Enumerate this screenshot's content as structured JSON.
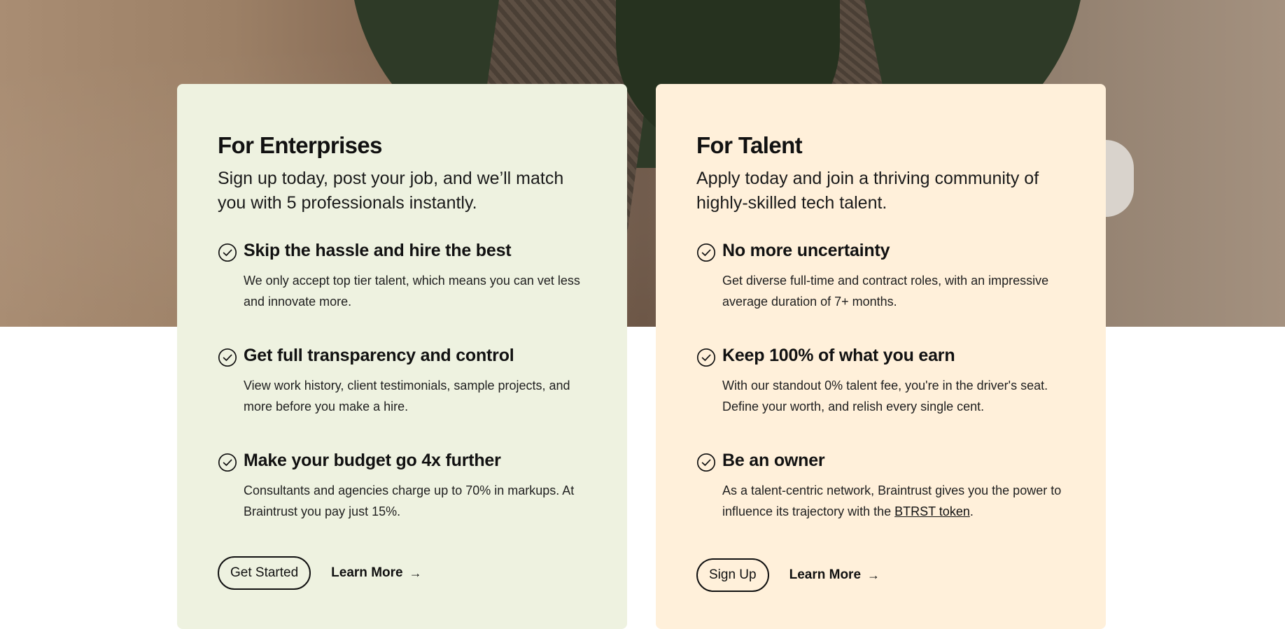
{
  "enterprise": {
    "title": "For Enterprises",
    "subtitle": "Sign up today, post your job, and we’ll match you with 5 professionals instantly.",
    "features": [
      {
        "heading": "Skip the hassle and hire the best",
        "description": "We only accept top tier talent, which means you can vet less and innovate more."
      },
      {
        "heading": "Get full transparency and control",
        "description": "View work history, client testimonials, sample projects, and more before you make a hire."
      },
      {
        "heading": "Make your budget go 4x further",
        "description": "Consultants and agencies charge up to 70% in markups. At Braintrust you pay just 15%."
      }
    ],
    "primary_button": "Get Started",
    "learn_more": "Learn More",
    "icon": "check-circle-icon"
  },
  "talent": {
    "title": "For Talent",
    "subtitle": "Apply today and join a thriving community of highly-skilled tech talent.",
    "features": [
      {
        "heading": "No more uncertainty",
        "description": "Get diverse full-time and contract roles, with an impressive average duration of 7+ months."
      },
      {
        "heading": "Keep 100% of what you earn",
        "description": "With our standout 0% talent fee, you're in the driver's seat. Define your worth, and relish every single cent."
      },
      {
        "heading": "Be an owner",
        "description_before_link": "As a talent-centric network, Braintrust gives you the power to influence its trajectory with the ",
        "description_link": "BTRST token",
        "description_after_link": "."
      }
    ],
    "primary_button": "Sign Up",
    "learn_more": "Learn More",
    "icon": "check-circle-icon"
  },
  "colors": {
    "enterprise_card_bg": "#eef2e0",
    "talent_card_bg": "#fff0da",
    "text": "#111111"
  },
  "arrow_glyph": "→"
}
